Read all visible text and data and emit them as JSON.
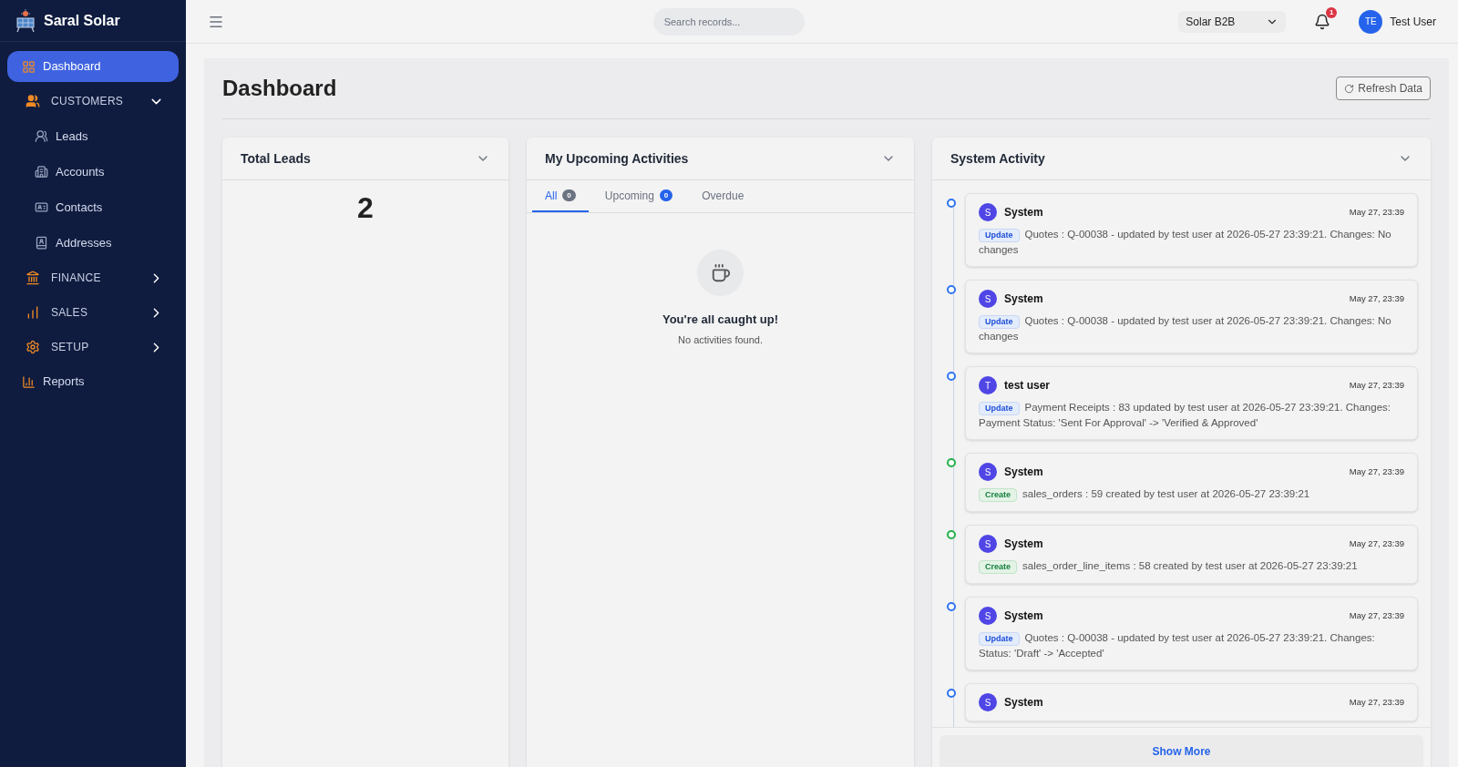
{
  "brand": {
    "name": "Saral Solar"
  },
  "sidebar": {
    "items": [
      {
        "kind": "link",
        "label": "Dashboard",
        "selected": true
      },
      {
        "kind": "group",
        "label": "CUSTOMERS",
        "expanded": true,
        "children": [
          {
            "label": "Leads"
          },
          {
            "label": "Accounts"
          },
          {
            "label": "Contacts"
          },
          {
            "label": "Addresses"
          }
        ]
      },
      {
        "kind": "group",
        "label": "FINANCE",
        "expanded": false
      },
      {
        "kind": "group",
        "label": "SALES",
        "expanded": false
      },
      {
        "kind": "group",
        "label": "SETUP",
        "expanded": false
      },
      {
        "kind": "link",
        "label": "Reports",
        "selected": false
      }
    ]
  },
  "header": {
    "search": {
      "placeholder": "Search records..."
    },
    "company": "Solar B2B",
    "notifications": "1",
    "user": {
      "initials": "TE",
      "name": "Test User"
    }
  },
  "page": {
    "title": "Dashboard",
    "refresh_button": "Refresh Data"
  },
  "total_leads": {
    "title": "Total Leads",
    "value": "2"
  },
  "activities": {
    "title": "My Upcoming Activities",
    "tabs": [
      {
        "label": "All",
        "count": "0",
        "color": "#6b7280",
        "selected": true
      },
      {
        "label": "Upcoming",
        "count": "0",
        "color": "#2563eb",
        "selected": false
      },
      {
        "label": "Overdue",
        "selected": false
      }
    ],
    "empty_title": "You're all caught up!",
    "empty_text": "No activities found."
  },
  "system_activity": {
    "title": "System Activity",
    "items": [
      {
        "kind": "update",
        "avatar": "S",
        "name": "System",
        "time": "May 27, 23:39",
        "tag": "Update",
        "text": "Quotes : Q-00038 - updated by test user at 2026-05-27 23:39:21. Changes: No changes"
      },
      {
        "kind": "update",
        "avatar": "S",
        "name": "System",
        "time": "May 27, 23:39",
        "tag": "Update",
        "text": "Quotes : Q-00038 - updated by test user at 2026-05-27 23:39:21. Changes: No changes"
      },
      {
        "kind": "update",
        "avatar": "T",
        "name": "test user",
        "time": "May 27, 23:39",
        "tag": "Update",
        "text": "Payment Receipts : 83 updated by test user at 2026-05-27 23:39:21. Changes: Payment Status: 'Sent For Approval' -> 'Verified & Approved'"
      },
      {
        "kind": "create",
        "avatar": "S",
        "name": "System",
        "time": "May 27, 23:39",
        "tag": "Create",
        "text": "sales_orders : 59 created by test user at 2026-05-27 23:39:21"
      },
      {
        "kind": "create",
        "avatar": "S",
        "name": "System",
        "time": "May 27, 23:39",
        "tag": "Create",
        "text": "sales_order_line_items : 58 created by test user at 2026-05-27 23:39:21"
      },
      {
        "kind": "update",
        "avatar": "S",
        "name": "System",
        "time": "May 27, 23:39",
        "tag": "Update",
        "text": "Quotes : Q-00038 - updated by test user at 2026-05-27 23:39:21. Changes: Status: 'Draft' -> 'Accepted'"
      },
      {
        "kind": "update",
        "avatar": "S",
        "name": "System",
        "time": "May 27, 23:39"
      }
    ],
    "show_more": "Show More"
  }
}
